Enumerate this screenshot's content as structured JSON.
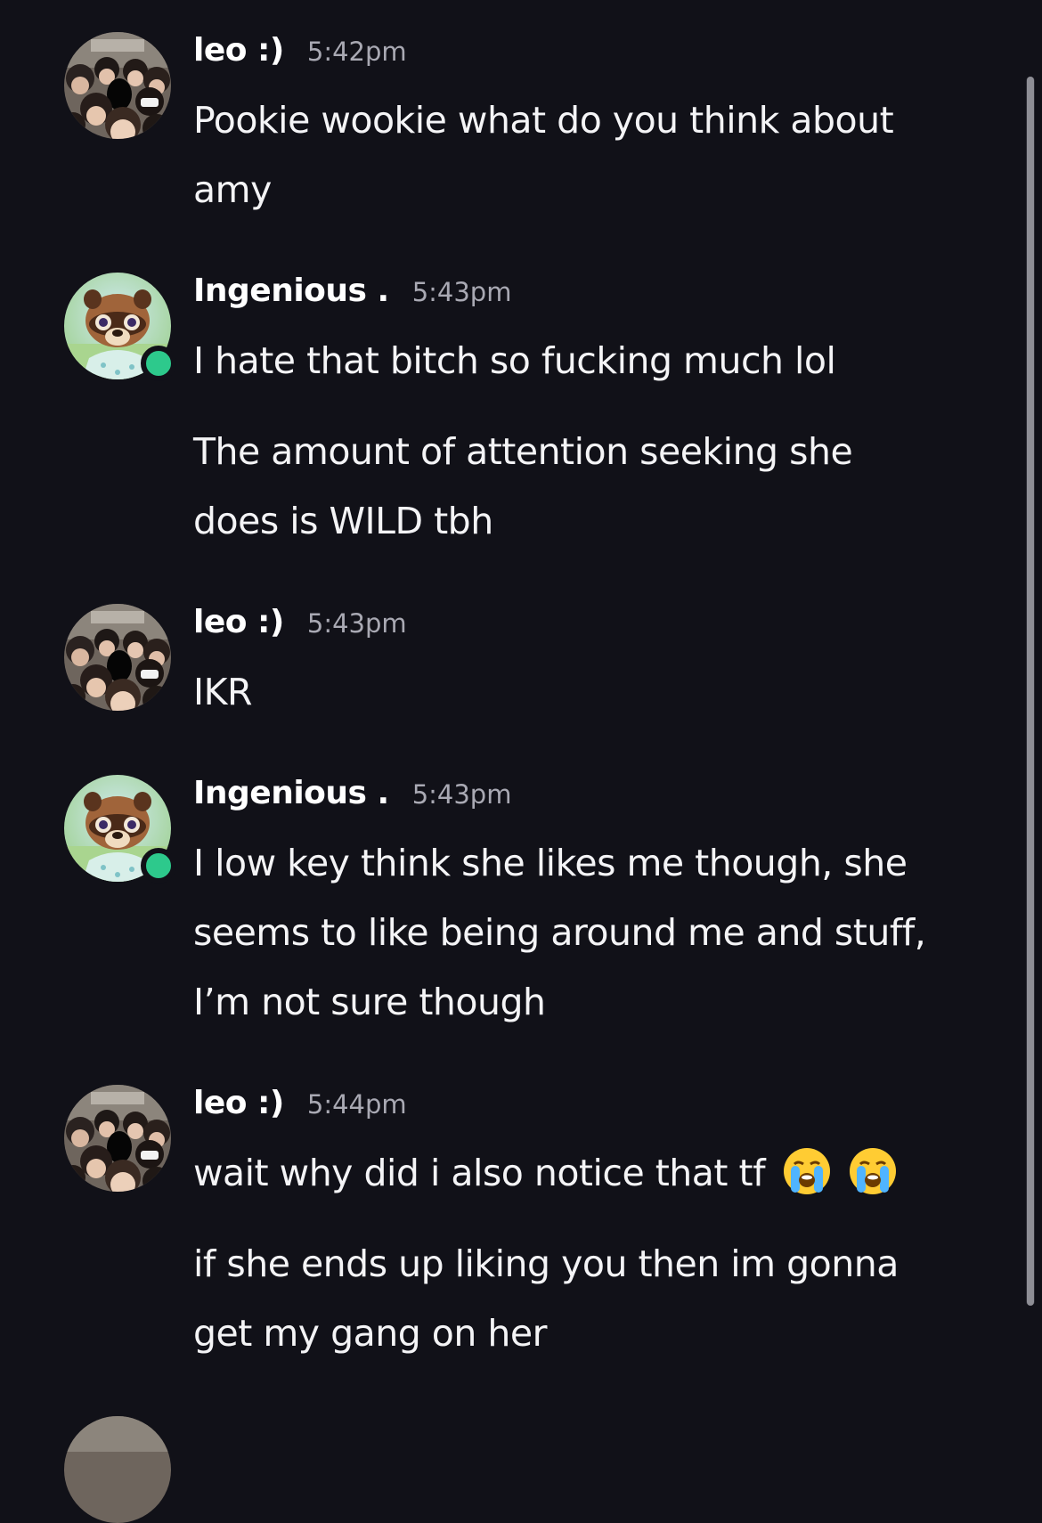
{
  "messages": [
    {
      "author": "leo :)",
      "time": "5:42pm",
      "avatar": "group-photo",
      "online": false,
      "lines": [
        "Pookie wookie what do you think about",
        "amy"
      ]
    },
    {
      "author": "Ingenious .",
      "time": "5:43pm",
      "avatar": "tom-nook",
      "online": true,
      "lines": [
        "I hate that bitch so fucking much lol"
      ],
      "followup": [
        "The amount of attention seeking she",
        "does is WILD tbh"
      ]
    },
    {
      "author": "leo :)",
      "time": "5:43pm",
      "avatar": "group-photo",
      "online": false,
      "lines": [
        "IKR"
      ]
    },
    {
      "author": "Ingenious .",
      "time": "5:43pm",
      "avatar": "tom-nook",
      "online": true,
      "lines": [
        "I low key think she likes me though, she",
        "seems to like being around me and stuff,",
        "I’m not sure though"
      ]
    },
    {
      "author": "leo :)",
      "time": "5:44pm",
      "avatar": "group-photo",
      "online": false,
      "lines": [
        "wait why did i also notice that tf"
      ],
      "emojis": [
        "loudly-crying-face-icon",
        "loudly-crying-face-icon"
      ],
      "followup": [
        "if she ends up liking you then im gonna",
        "get my gang on her"
      ]
    }
  ],
  "colors": {
    "background": "#111118",
    "online": "#2dc98c",
    "timestamp": "#a9a9b3"
  }
}
